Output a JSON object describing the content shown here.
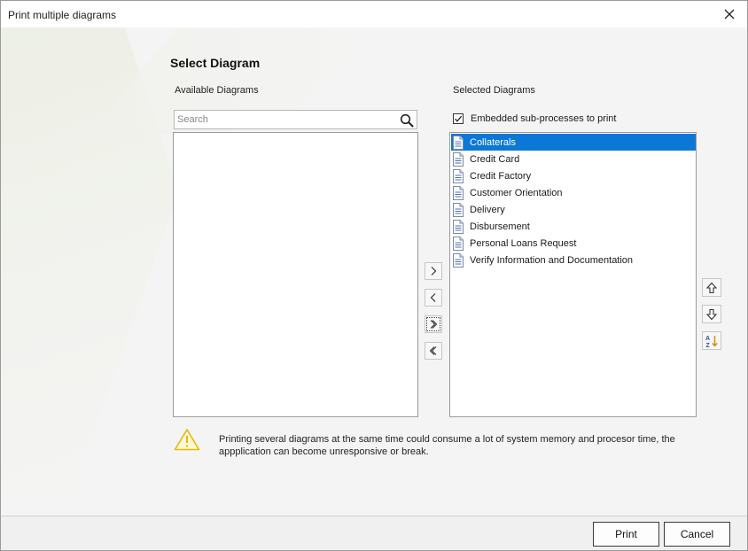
{
  "window": {
    "title": "Print multiple diagrams"
  },
  "heading": "Select Diagram",
  "available": {
    "label": "Available Diagrams",
    "search_placeholder": "Search",
    "search_value": "",
    "items": []
  },
  "selected": {
    "label": "Selected Diagrams",
    "embedded_label": "Embedded sub-processes to print",
    "embedded_checked": true,
    "items": [
      "Collaterals",
      "Credit Card",
      "Credit Factory",
      "Customer Orientation",
      "Delivery",
      "Disbursement",
      "Personal Loans Request",
      "Verify Information and Documentation"
    ],
    "selected_index": 0
  },
  "move_buttons": [
    "chevron-right-icon",
    "chevron-left-icon",
    "double-chevron-right-icon",
    "double-chevron-left-icon"
  ],
  "order_buttons": [
    "arrow-up-icon",
    "arrow-down-icon",
    "sort-az-icon"
  ],
  "warning": "Printing several diagrams at the same time could consume a lot of system memory and procesor time, the appplication can become unresponsive or break.",
  "buttons": {
    "print": "Print",
    "cancel": "Cancel"
  },
  "colors": {
    "selection": "#0b78d7",
    "warning_icon": "#e8b80c"
  }
}
